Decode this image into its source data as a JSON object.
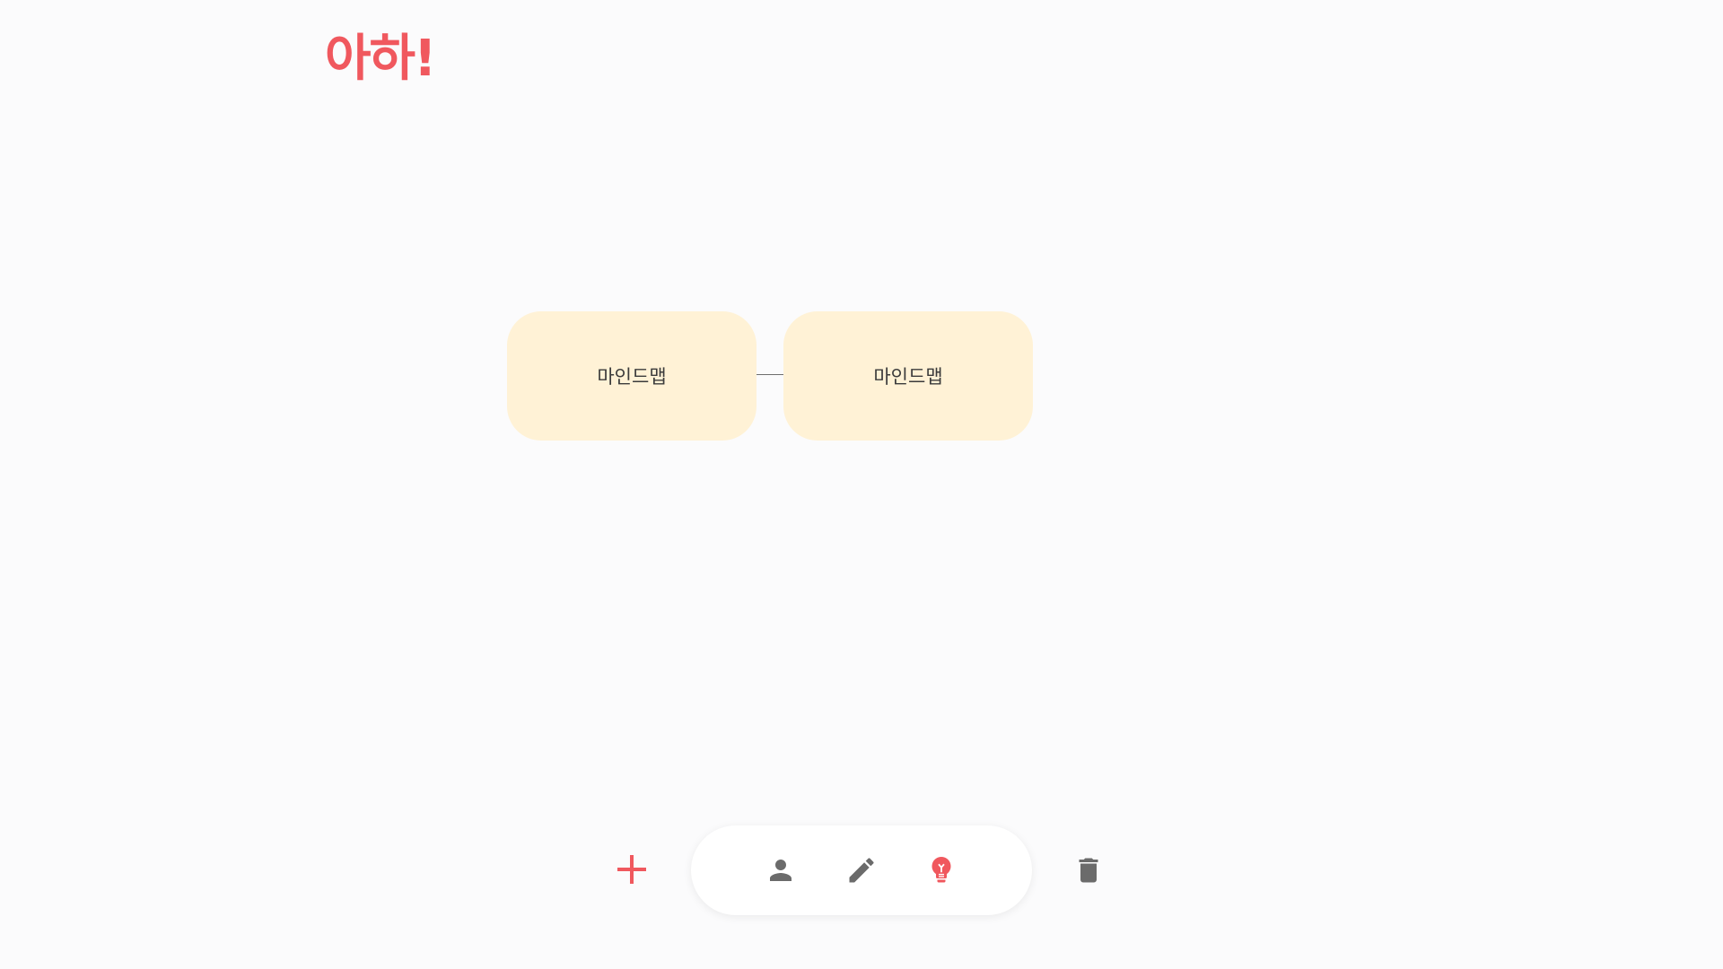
{
  "app": {
    "logo_text": "아하!",
    "brand_color": "#f0585e"
  },
  "mindmap": {
    "nodes": [
      {
        "label": "마인드맵",
        "color": "#fff2d6"
      },
      {
        "label": "마인드맵",
        "color": "#fff2d6"
      }
    ]
  },
  "toolbar": {
    "add_icon": "plus-icon",
    "mode_buttons": [
      {
        "icon": "person-icon",
        "active": false
      },
      {
        "icon": "pencil-icon",
        "active": false
      },
      {
        "icon": "lightbulb-icon",
        "active": true
      }
    ],
    "delete_icon": "trash-icon",
    "icon_color": "#6b6b6b",
    "active_color": "#f0585e"
  }
}
